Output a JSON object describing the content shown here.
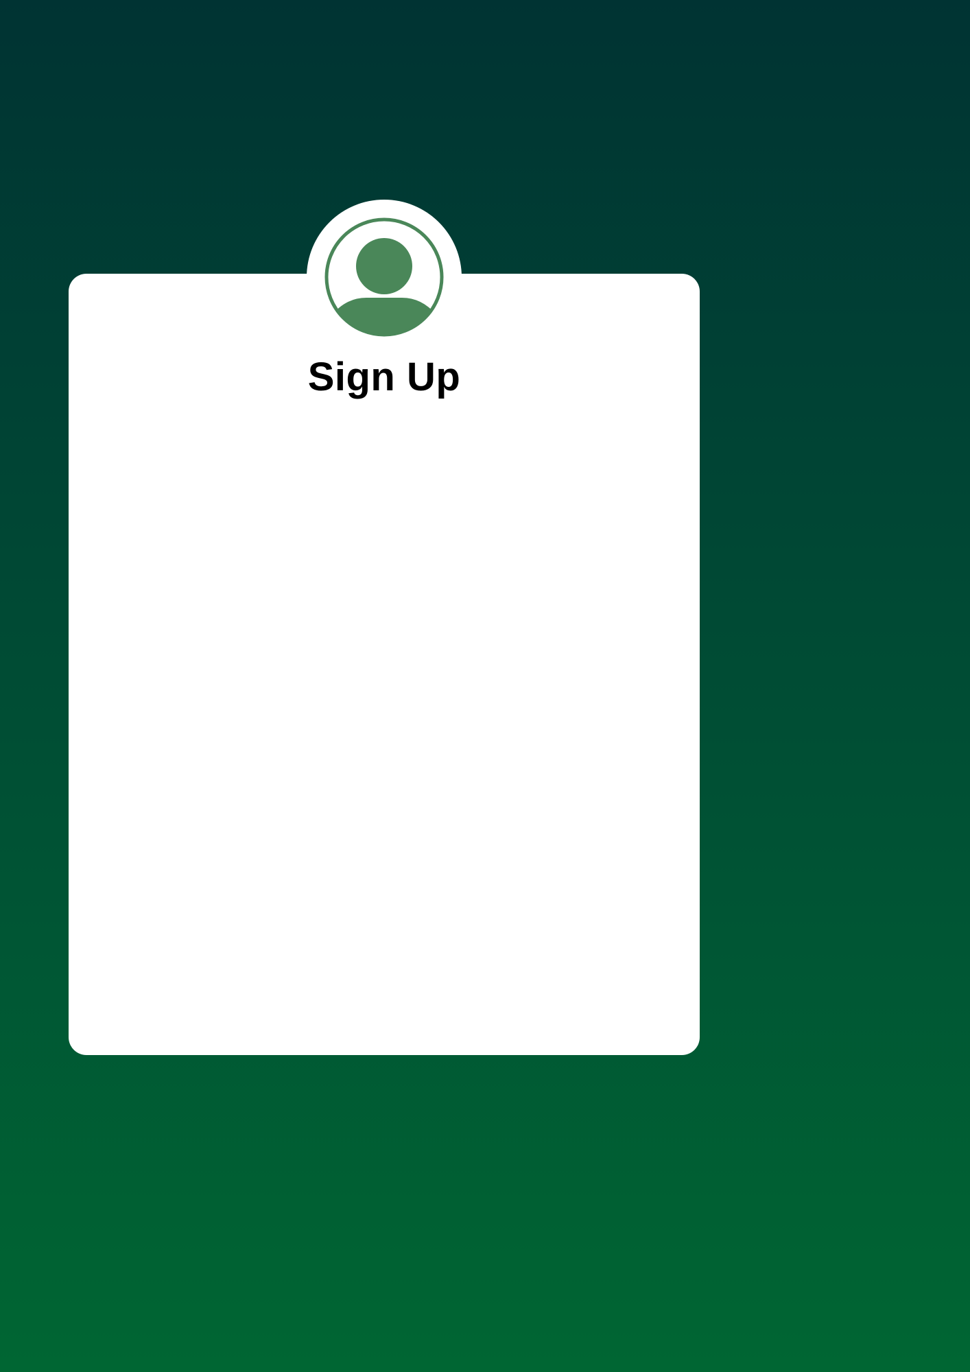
{
  "form": {
    "title": "Sign Up",
    "avatar_icon": "user-avatar-icon"
  },
  "colors": {
    "background_top": "#003333",
    "background_bottom": "#006633",
    "card": "#ffffff",
    "avatar_accent": "#4a8759",
    "title_text": "#000000"
  }
}
